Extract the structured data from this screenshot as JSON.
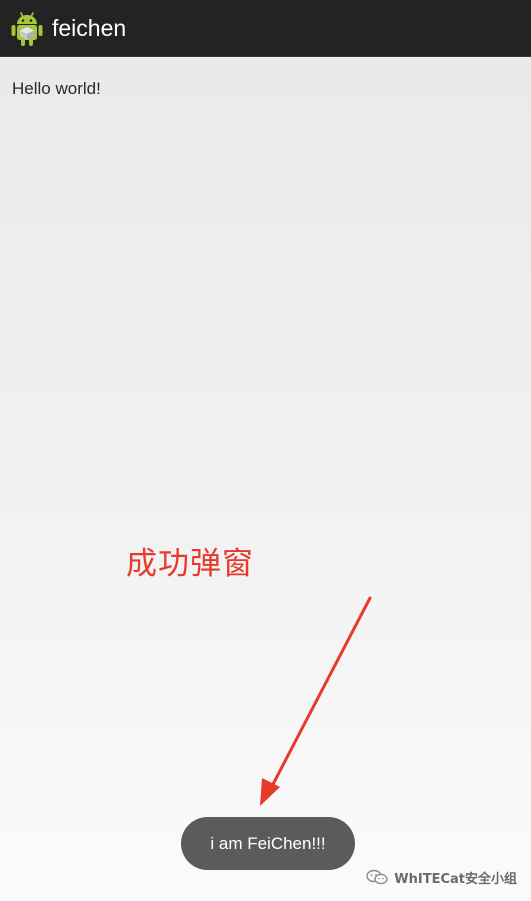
{
  "action_bar": {
    "title": "feichen",
    "icon": "android-robot-icon",
    "background_color": "#232323",
    "icon_color": "#a4c639"
  },
  "main": {
    "text": "Hello world!"
  },
  "annotation": {
    "label": "成功弹窗",
    "color": "#e63a2c",
    "arrow_icon": "red-arrow-icon"
  },
  "toast": {
    "message": "i am FeiChen!!!",
    "background_color": "#5b5b5b"
  },
  "watermark": {
    "text": "WhITECat安全小组",
    "icon": "wechat-icon"
  }
}
